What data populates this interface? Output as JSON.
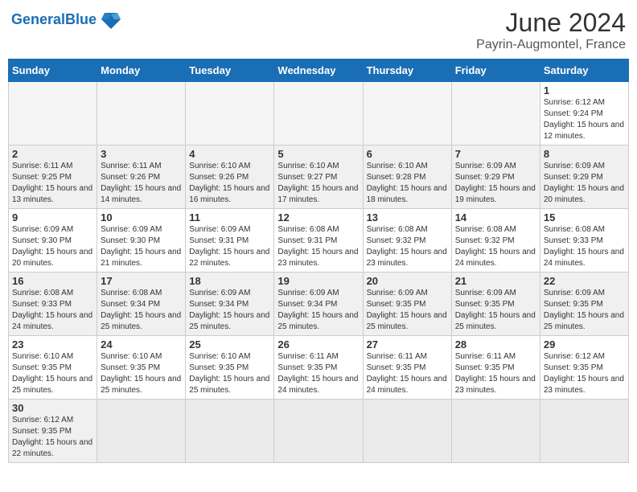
{
  "header": {
    "logo_general": "General",
    "logo_blue": "Blue",
    "month_year": "June 2024",
    "location": "Payrin-Augmontel, France"
  },
  "days_of_week": [
    "Sunday",
    "Monday",
    "Tuesday",
    "Wednesday",
    "Thursday",
    "Friday",
    "Saturday"
  ],
  "weeks": [
    {
      "shaded": false,
      "days": [
        {
          "num": "",
          "info": ""
        },
        {
          "num": "",
          "info": ""
        },
        {
          "num": "",
          "info": ""
        },
        {
          "num": "",
          "info": ""
        },
        {
          "num": "",
          "info": ""
        },
        {
          "num": "",
          "info": ""
        },
        {
          "num": "1",
          "info": "Sunrise: 6:12 AM\nSunset: 9:24 PM\nDaylight: 15 hours\nand 12 minutes."
        }
      ]
    },
    {
      "shaded": true,
      "days": [
        {
          "num": "2",
          "info": "Sunrise: 6:11 AM\nSunset: 9:25 PM\nDaylight: 15 hours\nand 13 minutes."
        },
        {
          "num": "3",
          "info": "Sunrise: 6:11 AM\nSunset: 9:26 PM\nDaylight: 15 hours\nand 14 minutes."
        },
        {
          "num": "4",
          "info": "Sunrise: 6:10 AM\nSunset: 9:26 PM\nDaylight: 15 hours\nand 16 minutes."
        },
        {
          "num": "5",
          "info": "Sunrise: 6:10 AM\nSunset: 9:27 PM\nDaylight: 15 hours\nand 17 minutes."
        },
        {
          "num": "6",
          "info": "Sunrise: 6:10 AM\nSunset: 9:28 PM\nDaylight: 15 hours\nand 18 minutes."
        },
        {
          "num": "7",
          "info": "Sunrise: 6:09 AM\nSunset: 9:29 PM\nDaylight: 15 hours\nand 19 minutes."
        },
        {
          "num": "8",
          "info": "Sunrise: 6:09 AM\nSunset: 9:29 PM\nDaylight: 15 hours\nand 20 minutes."
        }
      ]
    },
    {
      "shaded": false,
      "days": [
        {
          "num": "9",
          "info": "Sunrise: 6:09 AM\nSunset: 9:30 PM\nDaylight: 15 hours\nand 20 minutes."
        },
        {
          "num": "10",
          "info": "Sunrise: 6:09 AM\nSunset: 9:30 PM\nDaylight: 15 hours\nand 21 minutes."
        },
        {
          "num": "11",
          "info": "Sunrise: 6:09 AM\nSunset: 9:31 PM\nDaylight: 15 hours\nand 22 minutes."
        },
        {
          "num": "12",
          "info": "Sunrise: 6:08 AM\nSunset: 9:31 PM\nDaylight: 15 hours\nand 23 minutes."
        },
        {
          "num": "13",
          "info": "Sunrise: 6:08 AM\nSunset: 9:32 PM\nDaylight: 15 hours\nand 23 minutes."
        },
        {
          "num": "14",
          "info": "Sunrise: 6:08 AM\nSunset: 9:32 PM\nDaylight: 15 hours\nand 24 minutes."
        },
        {
          "num": "15",
          "info": "Sunrise: 6:08 AM\nSunset: 9:33 PM\nDaylight: 15 hours\nand 24 minutes."
        }
      ]
    },
    {
      "shaded": true,
      "days": [
        {
          "num": "16",
          "info": "Sunrise: 6:08 AM\nSunset: 9:33 PM\nDaylight: 15 hours\nand 24 minutes."
        },
        {
          "num": "17",
          "info": "Sunrise: 6:08 AM\nSunset: 9:34 PM\nDaylight: 15 hours\nand 25 minutes."
        },
        {
          "num": "18",
          "info": "Sunrise: 6:09 AM\nSunset: 9:34 PM\nDaylight: 15 hours\nand 25 minutes."
        },
        {
          "num": "19",
          "info": "Sunrise: 6:09 AM\nSunset: 9:34 PM\nDaylight: 15 hours\nand 25 minutes."
        },
        {
          "num": "20",
          "info": "Sunrise: 6:09 AM\nSunset: 9:35 PM\nDaylight: 15 hours\nand 25 minutes."
        },
        {
          "num": "21",
          "info": "Sunrise: 6:09 AM\nSunset: 9:35 PM\nDaylight: 15 hours\nand 25 minutes."
        },
        {
          "num": "22",
          "info": "Sunrise: 6:09 AM\nSunset: 9:35 PM\nDaylight: 15 hours\nand 25 minutes."
        }
      ]
    },
    {
      "shaded": false,
      "days": [
        {
          "num": "23",
          "info": "Sunrise: 6:10 AM\nSunset: 9:35 PM\nDaylight: 15 hours\nand 25 minutes."
        },
        {
          "num": "24",
          "info": "Sunrise: 6:10 AM\nSunset: 9:35 PM\nDaylight: 15 hours\nand 25 minutes."
        },
        {
          "num": "25",
          "info": "Sunrise: 6:10 AM\nSunset: 9:35 PM\nDaylight: 15 hours\nand 25 minutes."
        },
        {
          "num": "26",
          "info": "Sunrise: 6:11 AM\nSunset: 9:35 PM\nDaylight: 15 hours\nand 24 minutes."
        },
        {
          "num": "27",
          "info": "Sunrise: 6:11 AM\nSunset: 9:35 PM\nDaylight: 15 hours\nand 24 minutes."
        },
        {
          "num": "28",
          "info": "Sunrise: 6:11 AM\nSunset: 9:35 PM\nDaylight: 15 hours\nand 23 minutes."
        },
        {
          "num": "29",
          "info": "Sunrise: 6:12 AM\nSunset: 9:35 PM\nDaylight: 15 hours\nand 23 minutes."
        }
      ]
    },
    {
      "shaded": true,
      "days": [
        {
          "num": "30",
          "info": "Sunrise: 6:12 AM\nSunset: 9:35 PM\nDaylight: 15 hours\nand 22 minutes."
        },
        {
          "num": "",
          "info": ""
        },
        {
          "num": "",
          "info": ""
        },
        {
          "num": "",
          "info": ""
        },
        {
          "num": "",
          "info": ""
        },
        {
          "num": "",
          "info": ""
        },
        {
          "num": "",
          "info": ""
        }
      ]
    }
  ]
}
